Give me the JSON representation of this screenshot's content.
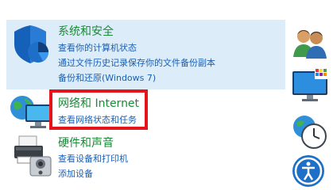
{
  "categories": [
    {
      "title": "系统和安全",
      "links": [
        "查看你的计算机状态",
        "通过文件历史记录保存你的文件备份副本",
        "备份和还原(Windows 7)"
      ],
      "icon": "shield-icon"
    },
    {
      "title": "网络和 Internet",
      "links": [
        "查看网络状态和任务"
      ],
      "icon": "network-globe-icon"
    },
    {
      "title": "硬件和声音",
      "links": [
        "查看设备和打印机",
        "添加设备"
      ],
      "icon": "printer-icon"
    }
  ],
  "side_icons": [
    "user-accounts-icon",
    "appearance-display-icon",
    "clock-region-icon",
    "ease-of-access-icon"
  ],
  "colors": {
    "title_green": "#1a8a36",
    "link_blue": "#1a5fb4",
    "highlight_red": "#e5141a",
    "hover_bg": "#dcecf8"
  }
}
